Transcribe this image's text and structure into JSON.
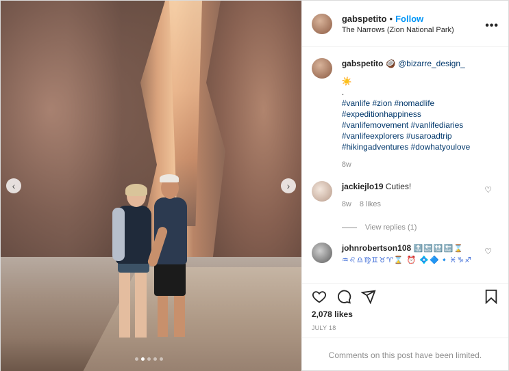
{
  "header": {
    "username": "gabspetito",
    "separator": "•",
    "follow_label": "Follow",
    "location": "The Narrows (Zion National Park)",
    "more_glyph": "•••"
  },
  "nav": {
    "prev_glyph": "‹",
    "next_glyph": "›"
  },
  "caption": {
    "username": "gabspetito",
    "emoji": "🥥",
    "mention": "@bizarre_design_",
    "sun": "☀️",
    "dot1": ".",
    "hashtags": "#vanlife #zion #nomadlife #expeditionhappiness #vanlifemovement #vanlifediaries #vanlifeexplorers #usaroadtrip #hikingadventures #dowhatyoulove",
    "age": "8w"
  },
  "comments": [
    {
      "username": "jackiejlo19",
      "text": "Cuties!",
      "age": "8w",
      "likes": "8 likes",
      "view_replies": "View replies (1)"
    },
    {
      "username": "johnrobertson108",
      "text": "🔝🔙🔛🔚⌛♒♌♎♍♊♉♈⌛ ⏰ 💠🔷🔹♓♑♐"
    }
  ],
  "actions": {
    "likes": "2,078 likes",
    "date": "JULY 18",
    "limited": "Comments on this post have been limited."
  },
  "icons": [
    "more-icon",
    "heart-icon",
    "comment-icon",
    "share-icon",
    "bookmark-icon",
    "chevron-left-icon",
    "chevron-right-icon"
  ]
}
